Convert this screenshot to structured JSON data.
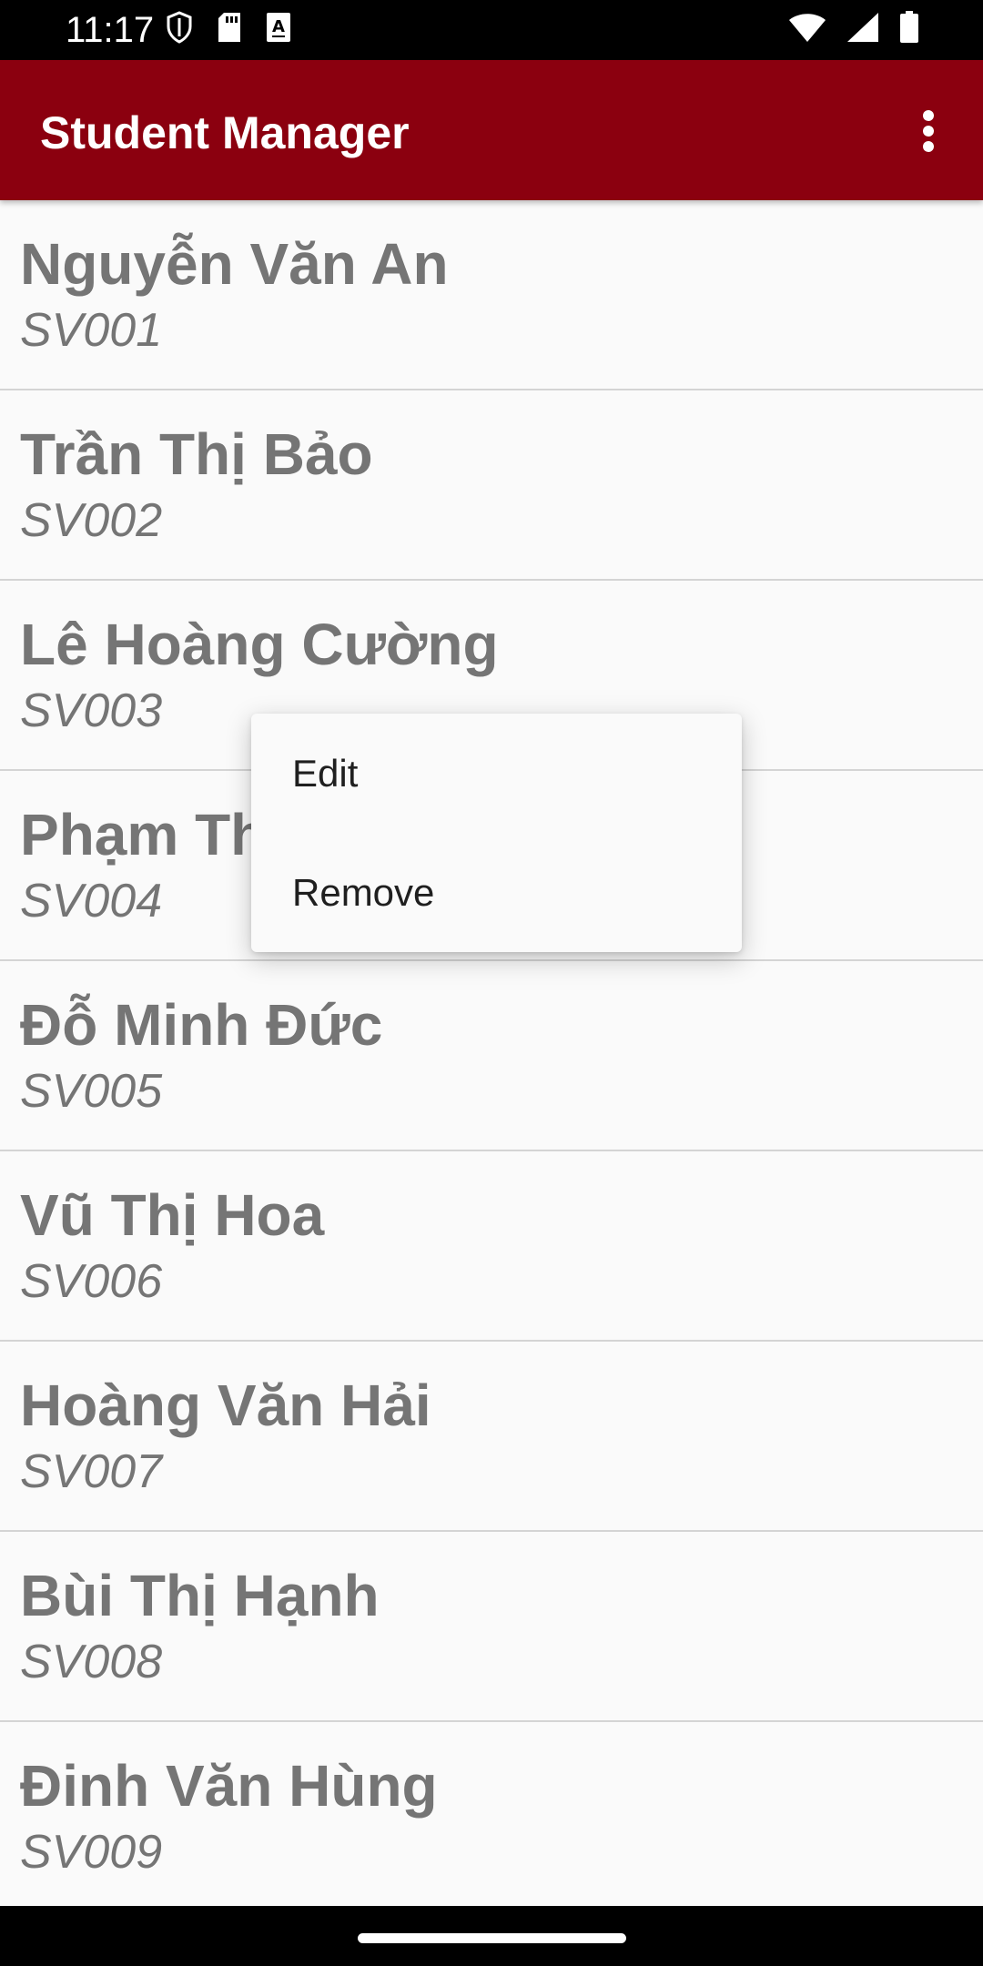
{
  "status_bar": {
    "time": "11:17",
    "left_icons": [
      "shield-icon",
      "sd-card-icon",
      "accessibility-a-icon"
    ],
    "right_icons": [
      "wifi-icon",
      "signal-icon",
      "battery-icon"
    ]
  },
  "app_bar": {
    "title": "Student Manager",
    "overflow_icon": "more-vertical-icon",
    "color": "#8b000f"
  },
  "students": [
    {
      "name": "Nguyễn Văn An",
      "id": "SV001"
    },
    {
      "name": "Trần Thị Bảo",
      "id": "SV002"
    },
    {
      "name": "Lê Hoàng Cường",
      "id": "SV003"
    },
    {
      "name": "Phạm Th",
      "id": "SV004"
    },
    {
      "name": "Đỗ Minh Đức",
      "id": "SV005"
    },
    {
      "name": "Vũ Thị Hoa",
      "id": "SV006"
    },
    {
      "name": "Hoàng Văn Hải",
      "id": "SV007"
    },
    {
      "name": "Bùi Thị Hạnh",
      "id": "SV008"
    },
    {
      "name": "Đinh Văn Hùng",
      "id": "SV009"
    }
  ],
  "context_menu": {
    "items": [
      {
        "label": "Edit"
      },
      {
        "label": "Remove"
      }
    ]
  },
  "nav_bar": {
    "home_handle": "home-handle"
  }
}
